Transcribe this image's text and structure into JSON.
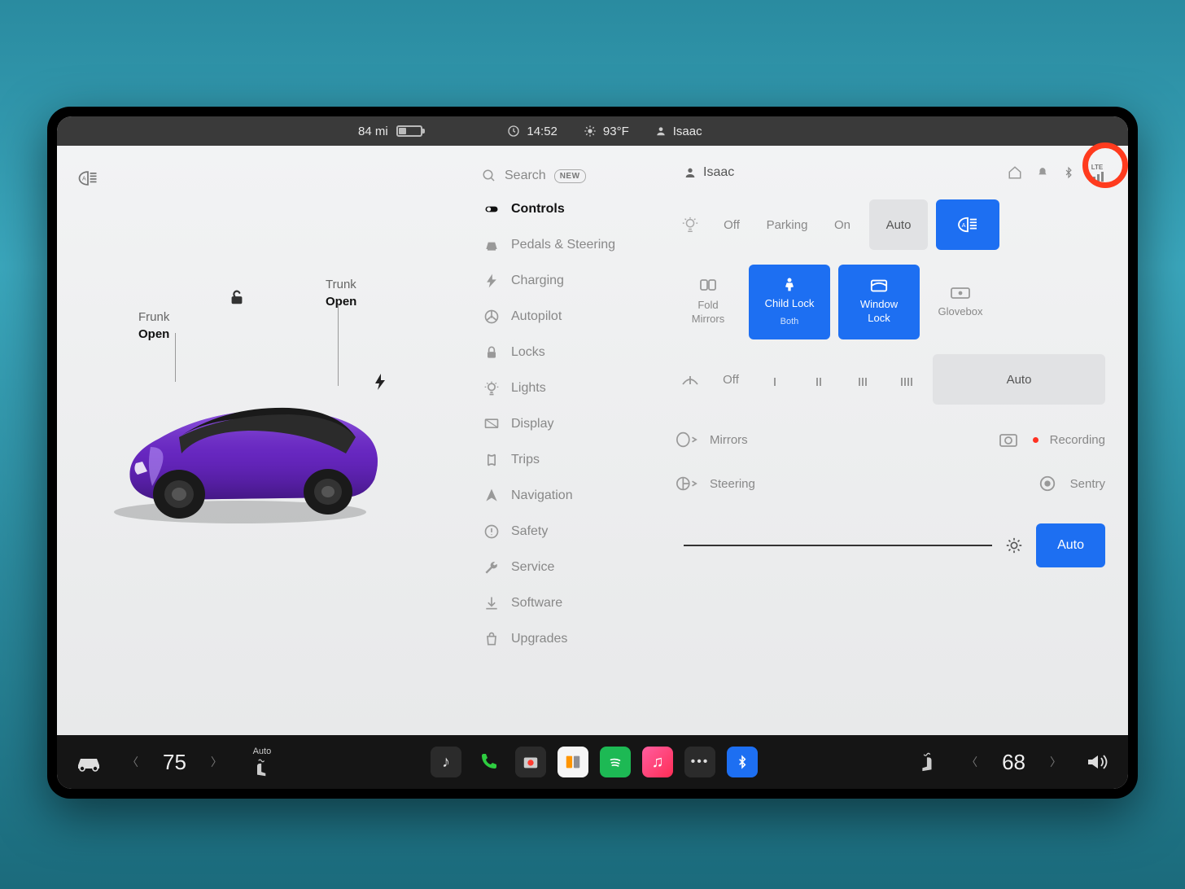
{
  "status": {
    "range": "84 mi",
    "time": "14:52",
    "temp": "93°F",
    "profile": "Isaac"
  },
  "vehicle": {
    "frunk_label": "Frunk",
    "frunk_state": "Open",
    "trunk_label": "Trunk",
    "trunk_state": "Open"
  },
  "nav": {
    "search": "Search",
    "new_badge": "NEW",
    "items": [
      {
        "label": "Controls",
        "icon": "toggle"
      },
      {
        "label": "Pedals & Steering",
        "icon": "car-seat"
      },
      {
        "label": "Charging",
        "icon": "bolt"
      },
      {
        "label": "Autopilot",
        "icon": "wheel"
      },
      {
        "label": "Locks",
        "icon": "lock"
      },
      {
        "label": "Lights",
        "icon": "bulb"
      },
      {
        "label": "Display",
        "icon": "display"
      },
      {
        "label": "Trips",
        "icon": "trips"
      },
      {
        "label": "Navigation",
        "icon": "nav"
      },
      {
        "label": "Safety",
        "icon": "safety"
      },
      {
        "label": "Service",
        "icon": "wrench"
      },
      {
        "label": "Software",
        "icon": "download"
      },
      {
        "label": "Upgrades",
        "icon": "bag"
      }
    ],
    "active_index": 0
  },
  "controls": {
    "profile": "Isaac",
    "signal_label": "LTE",
    "lights": {
      "off": "Off",
      "parking": "Parking",
      "on": "On",
      "auto": "Auto"
    },
    "quick": {
      "fold_mirrors": "Fold\nMirrors",
      "child_lock": "Child Lock",
      "child_lock_sub": "Both",
      "window_lock": "Window\nLock",
      "glovebox": "Glovebox"
    },
    "wipers": {
      "off": "Off",
      "auto": "Auto"
    },
    "toggles": {
      "mirrors": "Mirrors",
      "recording": "Recording",
      "steering": "Steering",
      "sentry": "Sentry"
    },
    "brightness_auto": "Auto"
  },
  "appbar": {
    "left_temp": "75",
    "right_temp": "68",
    "seat_auto": "Auto"
  }
}
